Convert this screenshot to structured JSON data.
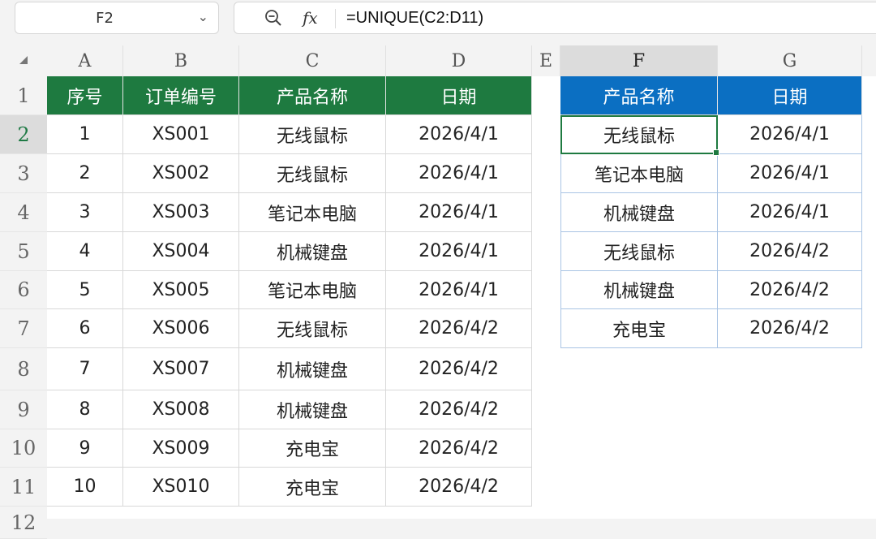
{
  "name_box": {
    "ref": "F2"
  },
  "formula_bar": {
    "fx": "fx",
    "formula": "=UNIQUE(C2:D11)"
  },
  "columns": [
    "A",
    "B",
    "C",
    "D",
    "E",
    "F",
    "G"
  ],
  "rows": [
    "1",
    "2",
    "3",
    "4",
    "5",
    "6",
    "7",
    "8",
    "9",
    "10",
    "11",
    "12"
  ],
  "selected_column": "F",
  "selected_row": "2",
  "left_table": {
    "headers": [
      "序号",
      "订单编号",
      "产品名称",
      "日期"
    ],
    "rows": [
      [
        "1",
        "XS001",
        "无线鼠标",
        "2026/4/1"
      ],
      [
        "2",
        "XS002",
        "无线鼠标",
        "2026/4/1"
      ],
      [
        "3",
        "XS003",
        "笔记本电脑",
        "2026/4/1"
      ],
      [
        "4",
        "XS004",
        "机械键盘",
        "2026/4/1"
      ],
      [
        "5",
        "XS005",
        "笔记本电脑",
        "2026/4/1"
      ],
      [
        "6",
        "XS006",
        "无线鼠标",
        "2026/4/2"
      ],
      [
        "7",
        "XS007",
        "机械键盘",
        "2026/4/2"
      ],
      [
        "8",
        "XS008",
        "机械键盘",
        "2026/4/2"
      ],
      [
        "9",
        "XS009",
        "充电宝",
        "2026/4/2"
      ],
      [
        "10",
        "XS010",
        "充电宝",
        "2026/4/2"
      ]
    ],
    "header_color": "#1e7a40"
  },
  "right_table": {
    "headers": [
      "产品名称",
      "日期"
    ],
    "rows": [
      [
        "无线鼠标",
        "2026/4/1"
      ],
      [
        "笔记本电脑",
        "2026/4/1"
      ],
      [
        "机械键盘",
        "2026/4/1"
      ],
      [
        "无线鼠标",
        "2026/4/2"
      ],
      [
        "机械键盘",
        "2026/4/2"
      ],
      [
        "充电宝",
        "2026/4/2"
      ]
    ],
    "header_color": "#0b6fc2"
  }
}
